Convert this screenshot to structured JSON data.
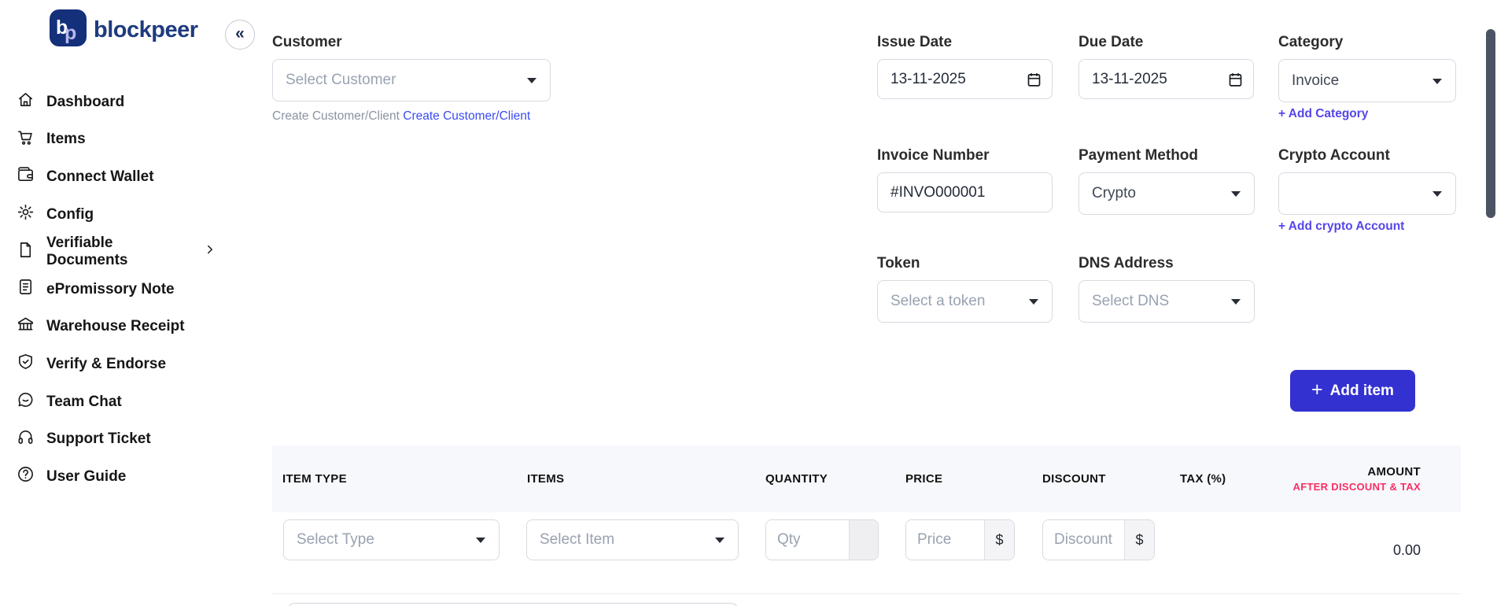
{
  "brand": {
    "name": "blockpeer"
  },
  "sidebar": {
    "collapse_glyph": "«",
    "items": [
      {
        "label": "Dashboard",
        "icon": "home-icon"
      },
      {
        "label": "Items",
        "icon": "cart-icon"
      },
      {
        "label": "Connect Wallet",
        "icon": "wallet-icon"
      },
      {
        "label": "Config",
        "icon": "gear-icon"
      },
      {
        "label": "Verifiable Documents",
        "icon": "document-icon",
        "expandable": true
      },
      {
        "label": "ePromissory Note",
        "icon": "note-icon"
      },
      {
        "label": "Warehouse Receipt",
        "icon": "warehouse-icon"
      },
      {
        "label": "Verify & Endorse",
        "icon": "shield-check-icon"
      },
      {
        "label": "Team Chat",
        "icon": "chat-icon"
      },
      {
        "label": "Support Ticket",
        "icon": "headset-icon"
      },
      {
        "label": "User Guide",
        "icon": "question-icon"
      }
    ]
  },
  "form": {
    "customer": {
      "label": "Customer",
      "placeholder": "Select Customer",
      "helper_text": "Create Customer/Client",
      "helper_link": "Create Customer/Client"
    },
    "issue_date": {
      "label": "Issue Date",
      "value": "13-11-2025"
    },
    "due_date": {
      "label": "Due Date",
      "value": "13-11-2025"
    },
    "category": {
      "label": "Category",
      "value": "Invoice",
      "add_link": "+ Add Category"
    },
    "invoice_number": {
      "label": "Invoice Number",
      "value": "#INVO000001"
    },
    "payment_method": {
      "label": "Payment Method",
      "value": "Crypto"
    },
    "crypto_account": {
      "label": "Crypto Account",
      "value": "",
      "add_link": "+ Add crypto Account"
    },
    "token": {
      "label": "Token",
      "placeholder": "Select a token"
    },
    "dns_address": {
      "label": "DNS Address",
      "placeholder": "Select DNS"
    }
  },
  "actions": {
    "plus_glyph": "+",
    "add_item_label": "Add item"
  },
  "items_table": {
    "columns": [
      "ITEM TYPE",
      "ITEMS",
      "QUANTITY",
      "PRICE",
      "DISCOUNT",
      "TAX (%)",
      "AMOUNT"
    ],
    "amount_subheader": "AFTER DISCOUNT & TAX",
    "row": {
      "item_type_placeholder": "Select Type",
      "item_placeholder": "Select Item",
      "qty_placeholder": "Qty",
      "price_placeholder": "Price",
      "discount_placeholder": "Discount",
      "currency": "$",
      "amount": "0.00"
    }
  },
  "colors": {
    "primary_button": "#3431d1",
    "add_link": "#5546e8",
    "helper_link": "#3b4bf0",
    "amount_subheader_pink": "#f92e63",
    "brand_navy": "#1e3b7e",
    "table_header_bg": "#f7f8fb",
    "scrollbar_thumb": "#4c5463"
  }
}
